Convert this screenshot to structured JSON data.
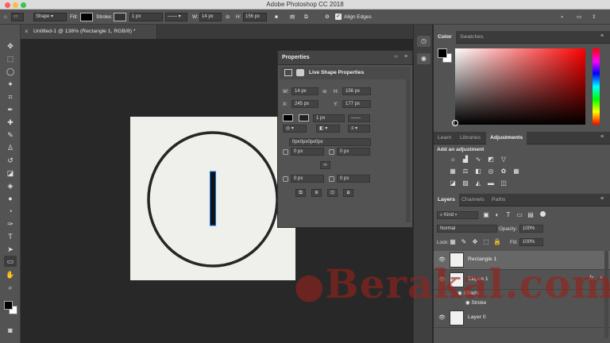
{
  "app": {
    "title": "Adobe Photoshop CC 2018"
  },
  "options": {
    "shape_mode": "Shape",
    "fill_label": "Fill:",
    "stroke_label": "Stroke:",
    "stroke_width": "1 px",
    "w_label": "W:",
    "w_value": "14 px",
    "h_label": "H:",
    "h_value": "156 px",
    "align_edges": "Align Edges"
  },
  "document": {
    "tab_title": "Untitled-1 @ 138% (Rectangle 1, RGB/8) *"
  },
  "properties": {
    "title": "Properties",
    "subtitle": "Live Shape Properties",
    "w_label": "W:",
    "w_value": "14 px",
    "h_label": "H:",
    "h_value": "156 px",
    "x_label": "X:",
    "x_value": "245 px",
    "y_label": "Y:",
    "y_value": "177 px",
    "stroke_width": "1 px",
    "corners_all": "0px0px0px0px",
    "corner_tl": "0 px",
    "corner_tr": "0 px",
    "corner_bl": "0 px",
    "corner_br": "0 px"
  },
  "color_panel": {
    "tabs": [
      "Color",
      "Swatches"
    ],
    "fg": "#000000",
    "bg": "#ffffff"
  },
  "adjustments_panel": {
    "tabs": [
      "Learn",
      "Libraries",
      "Adjustments"
    ],
    "add_label": "Add an adjustment"
  },
  "layers_panel": {
    "tabs": [
      "Layers",
      "Channels",
      "Paths"
    ],
    "filter_kind": "Kind",
    "blend_mode": "Normal",
    "opacity_label": "Opacity:",
    "opacity_value": "100%",
    "lock_label": "Lock:",
    "fill_label": "Fill:",
    "fill_value": "100%",
    "layers": [
      "Rectangle 1",
      "Ellipse 1",
      "Layer 0"
    ],
    "effects_label": "Effects",
    "stroke_label": "Stroke",
    "fx_badge": "fx"
  },
  "watermark": {
    "text": "Berakal.com"
  },
  "colors": {
    "accent": "#1473e6",
    "panel": "#535353",
    "canvas": "#282828"
  }
}
